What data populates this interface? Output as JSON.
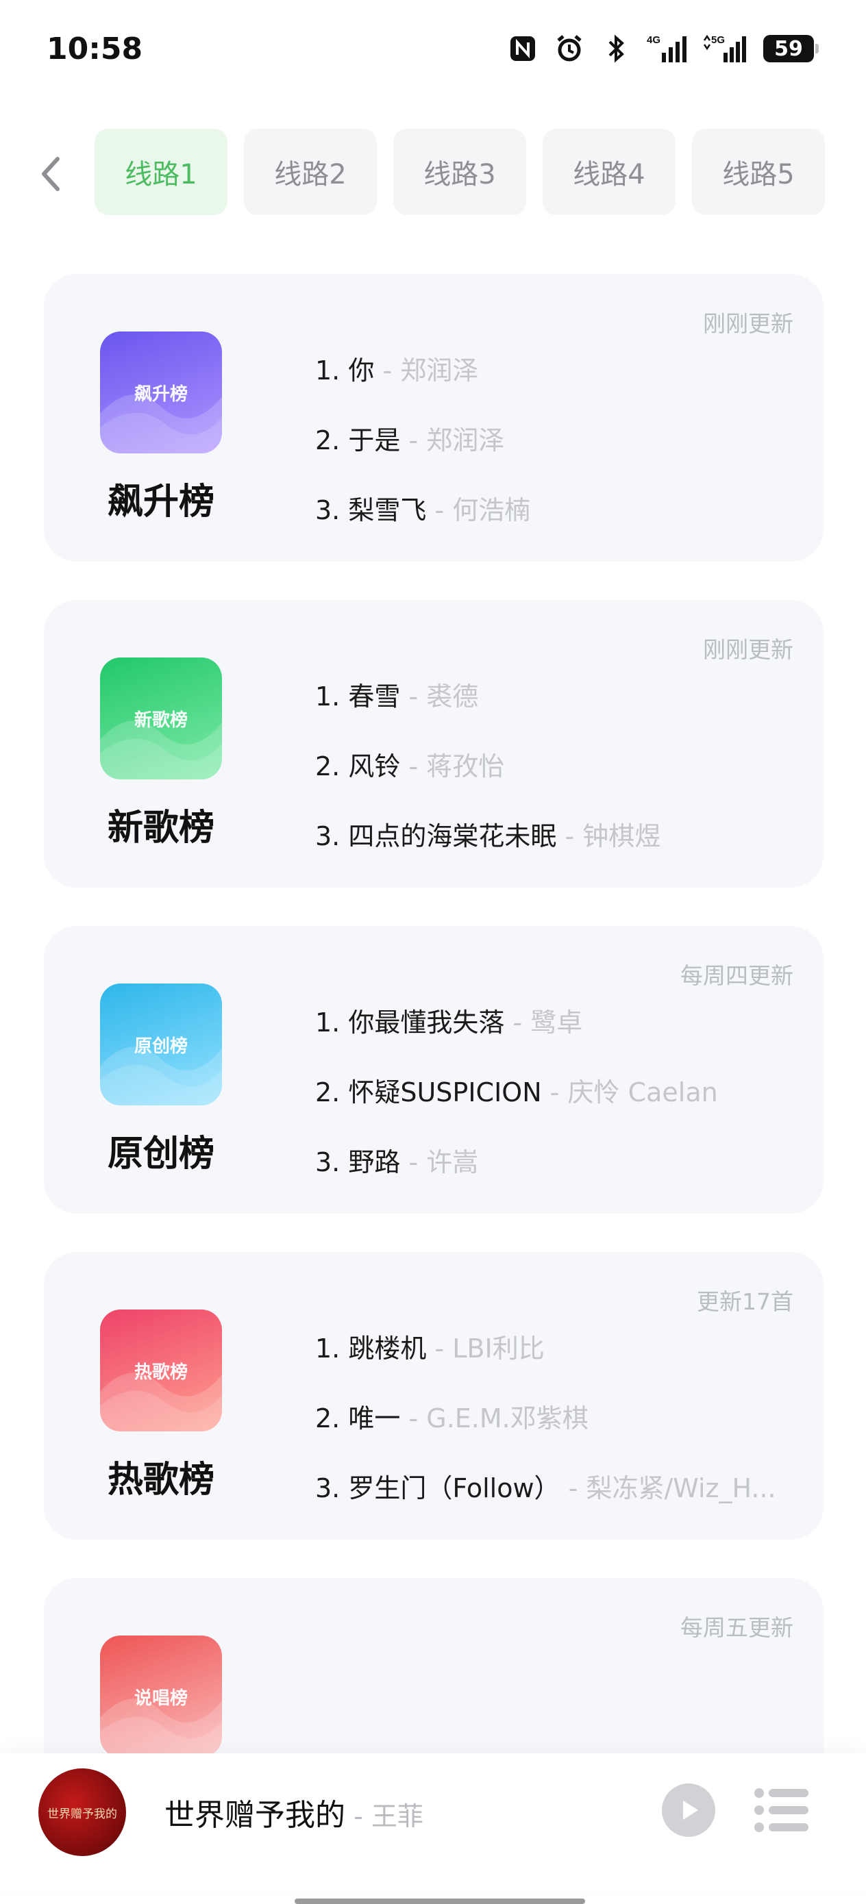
{
  "status_bar": {
    "time": "10:58",
    "battery": "59",
    "icons": [
      "nfc-icon",
      "alarm-icon",
      "bluetooth-icon",
      "signal-4g-icon",
      "signal-5g-icon",
      "battery-icon"
    ],
    "net_4g": "4G",
    "net_5g": "5G"
  },
  "tabs": [
    {
      "label": "线路1",
      "active": true
    },
    {
      "label": "线路2",
      "active": false
    },
    {
      "label": "线路3",
      "active": false
    },
    {
      "label": "线路4",
      "active": false
    },
    {
      "label": "线路5",
      "active": false
    }
  ],
  "charts": [
    {
      "title": "飙升榜",
      "cover_label": "飙升榜",
      "update": "刚刚更新",
      "colors": [
        "#6f5cf0",
        "#a78bfa"
      ],
      "tracks": [
        {
          "num": "1.",
          "song": "你",
          "artist": "郑润泽"
        },
        {
          "num": "2.",
          "song": "于是",
          "artist": "郑润泽"
        },
        {
          "num": "3.",
          "song": "梨雪飞",
          "artist": "何浩楠"
        }
      ]
    },
    {
      "title": "新歌榜",
      "cover_label": "新歌榜",
      "update": "刚刚更新",
      "colors": [
        "#2ecc71",
        "#6ee7a0"
      ],
      "tracks": [
        {
          "num": "1.",
          "song": "春雪",
          "artist": "裘德"
        },
        {
          "num": "2.",
          "song": "风铃",
          "artist": "蒋孜怡"
        },
        {
          "num": "3.",
          "song": "四点的海棠花未眠",
          "artist": "钟棋煜"
        }
      ]
    },
    {
      "title": "原创榜",
      "cover_label": "原创榜",
      "update": "每周四更新",
      "colors": [
        "#33bbe8",
        "#8fdcff"
      ],
      "tracks": [
        {
          "num": "1.",
          "song": "你最懂我失落",
          "artist": "鹭卓"
        },
        {
          "num": "2.",
          "song": "怀疑SUSPICION",
          "artist": "庆怜 Caelan"
        },
        {
          "num": "3.",
          "song": "野路",
          "artist": "许嵩"
        }
      ]
    },
    {
      "title": "热歌榜",
      "cover_label": "热歌榜",
      "update": "更新17首",
      "colors": [
        "#f0506e",
        "#ff9a8a"
      ],
      "tracks": [
        {
          "num": "1.",
          "song": "跳楼机",
          "artist": "LBI利比"
        },
        {
          "num": "2.",
          "song": "唯一",
          "artist": "G.E.M.邓紫棋"
        },
        {
          "num": "3.",
          "song": "罗生门（Follow）",
          "artist": "梨冻紧/Wiz_H..."
        }
      ]
    },
    {
      "title": "说唱榜",
      "cover_label": "说唱榜",
      "update": "每周五更新",
      "colors": [
        "#ef5a5a",
        "#f8b0b0"
      ],
      "tracks": []
    }
  ],
  "player": {
    "song": "世界赠予我的",
    "artist": "王菲",
    "art_text": "世界赠予我的"
  }
}
